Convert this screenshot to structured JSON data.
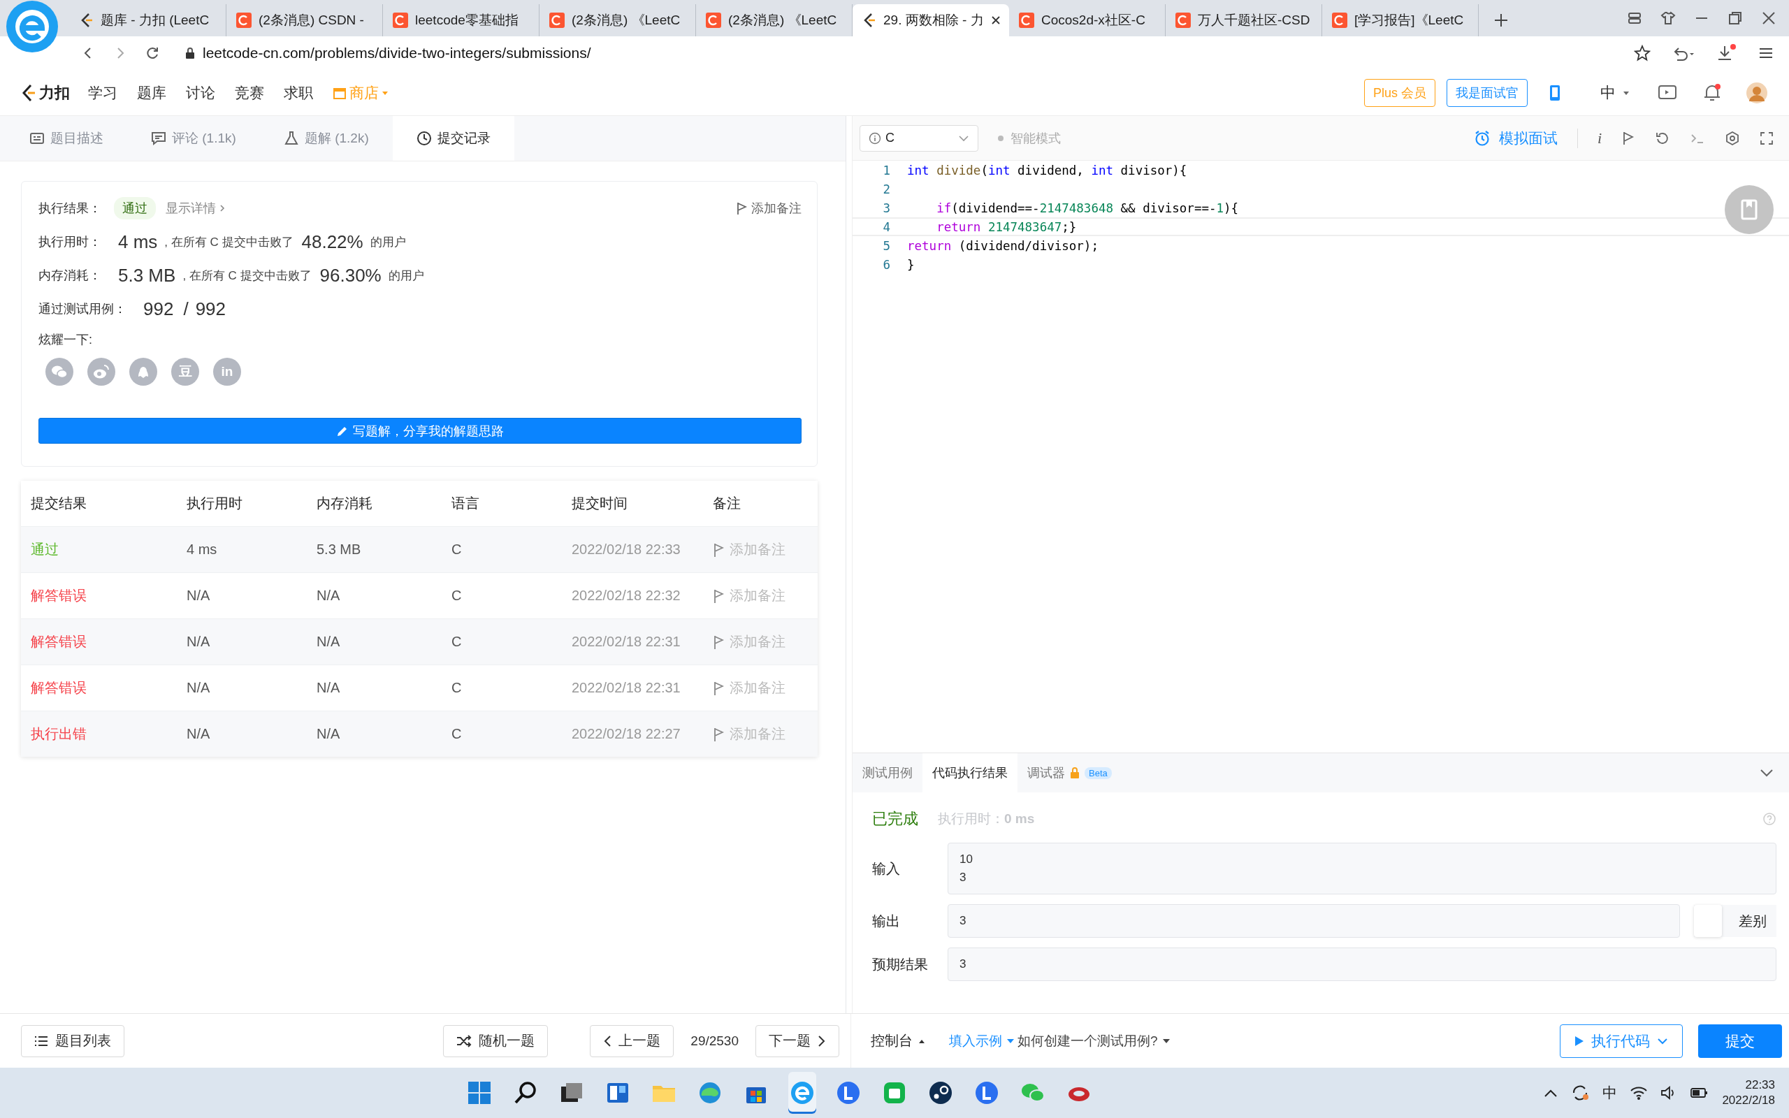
{
  "browser": {
    "tabs": [
      {
        "title": "题库 - 力扣 (LeetC",
        "kind": "leetcode",
        "selected": false
      },
      {
        "title": "(2条消息) CSDN -",
        "kind": "csdn",
        "selected": false
      },
      {
        "title": "leetcode零基础指",
        "kind": "csdn",
        "selected": false
      },
      {
        "title": "(2条消息) 《LeetC",
        "kind": "csdn",
        "selected": false
      },
      {
        "title": "(2条消息) 《LeetC",
        "kind": "csdn",
        "selected": false
      },
      {
        "title": "29. 两数相除 - 力",
        "kind": "leetcode",
        "selected": true
      },
      {
        "title": "Cocos2d-x社区-C",
        "kind": "csdn",
        "selected": false
      },
      {
        "title": "万人千题社区-CSD",
        "kind": "csdn",
        "selected": false
      },
      {
        "title": "[学习报告]《LeetC",
        "kind": "csdn",
        "selected": false
      }
    ],
    "address": "leetcode-cn.com/problems/divide-two-integers/submissions/"
  },
  "site_header": {
    "logo": "力扣",
    "nav": [
      {
        "label": "学习",
        "kind": "plain"
      },
      {
        "label": "题库",
        "kind": "plain"
      },
      {
        "label": "讨论",
        "kind": "plain"
      },
      {
        "label": "竞赛",
        "kind": "plain"
      },
      {
        "label": "求职",
        "kind": "plain"
      },
      {
        "label": "商店",
        "kind": "store"
      }
    ],
    "plus": "Plus 会员",
    "interviewer": "我是面试官",
    "language": "中"
  },
  "left_tabs": [
    {
      "label": "题目描述",
      "selected": false
    },
    {
      "label": "评论 (1.1k)",
      "selected": false
    },
    {
      "label": "题解 (1.2k)",
      "selected": false
    },
    {
      "label": "提交记录",
      "selected": true
    }
  ],
  "result_card": {
    "result_label": "执行结果：",
    "result": "通过",
    "details": "显示详情",
    "note": "添加备注",
    "time_label": "执行用时：",
    "time": "4 ms",
    "time_text": ", 在所有 C 提交中击败了",
    "time_pct": "48.22%",
    "time_suffix": "的用户",
    "mem_label": "内存消耗：",
    "mem": "5.3 MB",
    "mem_text": ", 在所有 C 提交中击败了",
    "mem_pct": "96.30%",
    "mem_suffix": "的用户",
    "cases_label": "通过测试用例：",
    "cases_passed": "992",
    "cases_sep": "/",
    "cases_total": "992",
    "share_label": "炫耀一下:",
    "share": [
      {
        "kind": "wechat"
      },
      {
        "kind": "weibo"
      },
      {
        "kind": "qq"
      },
      {
        "kind": "glyph",
        "glyph": "豆"
      },
      {
        "kind": "glyph",
        "glyph": "in"
      }
    ],
    "write_button": "写题解，分享我的解题思路"
  },
  "submissions": {
    "columns": [
      "提交结果",
      "执行用时",
      "内存消耗",
      "语言",
      "提交时间",
      "备注"
    ],
    "rows": [
      {
        "status": "通过",
        "color": "#5cb82a",
        "time": "4 ms",
        "memory": "5.3 MB",
        "language": "C",
        "submitted": "2022/02/18 22:33",
        "note": "添加备注"
      },
      {
        "status": "解答错误",
        "color": "#f5424a",
        "time": "N/A",
        "memory": "N/A",
        "language": "C",
        "submitted": "2022/02/18 22:32",
        "note": "添加备注"
      },
      {
        "status": "解答错误",
        "color": "#f5424a",
        "time": "N/A",
        "memory": "N/A",
        "language": "C",
        "submitted": "2022/02/18 22:31",
        "note": "添加备注"
      },
      {
        "status": "解答错误",
        "color": "#f5424a",
        "time": "N/A",
        "memory": "N/A",
        "language": "C",
        "submitted": "2022/02/18 22:31",
        "note": "添加备注"
      },
      {
        "status": "执行出错",
        "color": "#f5424a",
        "time": "N/A",
        "memory": "N/A",
        "language": "C",
        "submitted": "2022/02/18 22:27",
        "note": "添加备注"
      }
    ]
  },
  "editor": {
    "language": "C",
    "smart_mode": "智能模式",
    "mock_interview": "模拟面试",
    "info": "i",
    "lines": [
      {
        "number": "1",
        "tokens": [
          {
            "kind": "type",
            "text": "int"
          },
          {
            "kind": "func",
            "text": " divide"
          },
          {
            "kind": "plain",
            "text": "("
          },
          {
            "kind": "type",
            "text": "int"
          },
          {
            "kind": "plain",
            "text": " dividend, "
          },
          {
            "kind": "type",
            "text": "int"
          },
          {
            "kind": "plain",
            "text": " divisor){"
          }
        ]
      },
      {
        "number": "2"
      },
      {
        "number": "3",
        "tokens": [
          {
            "kind": "control",
            "text": "    if"
          },
          {
            "kind": "plain",
            "text": "(dividend==-"
          },
          {
            "kind": "number",
            "text": "2147483648"
          },
          {
            "kind": "plain",
            "text": " && divisor==-"
          },
          {
            "kind": "number",
            "text": "1"
          },
          {
            "kind": "plain",
            "text": "){"
          }
        ]
      },
      {
        "number": "4",
        "current": true,
        "tokens": [
          {
            "kind": "control",
            "text": "    return"
          },
          {
            "kind": "number",
            "text": " 2147483647"
          },
          {
            "kind": "plain",
            "text": ";}"
          }
        ]
      },
      {
        "number": "5",
        "tokens": [
          {
            "kind": "control",
            "text": "return"
          },
          {
            "kind": "plain",
            "text": " (dividend/divisor);"
          }
        ]
      },
      {
        "number": "6",
        "tokens": [
          {
            "kind": "plain",
            "text": "}"
          }
        ]
      }
    ]
  },
  "console": {
    "tabs": [
      {
        "label": "测试用例",
        "selected": false
      },
      {
        "label": "代码执行结果",
        "selected": true
      },
      {
        "label": "调试器",
        "selected": false,
        "badge": "Beta"
      }
    ],
    "status": "已完成",
    "time_label": "执行用时：",
    "time": "0 ms",
    "fields": [
      {
        "label": "输入",
        "lines": [
          "10",
          "3"
        ]
      },
      {
        "label": "输出",
        "lines": [
          "3"
        ],
        "diff": "差别",
        "diff_on": false
      },
      {
        "label": "预期结果",
        "lines": [
          "3"
        ]
      }
    ]
  },
  "footer": {
    "list": "题目列表",
    "random": "随机一题",
    "prev": "上一题",
    "position": "29/2530",
    "next": "下一题",
    "console": "控制台",
    "fill_example": "填入示例",
    "how_to": "如何创建一个测试用例?",
    "run": "执行代码",
    "submit": "提交"
  },
  "taskbar": {
    "ime": "中",
    "time": "22:33",
    "date": "2022/2/18"
  }
}
